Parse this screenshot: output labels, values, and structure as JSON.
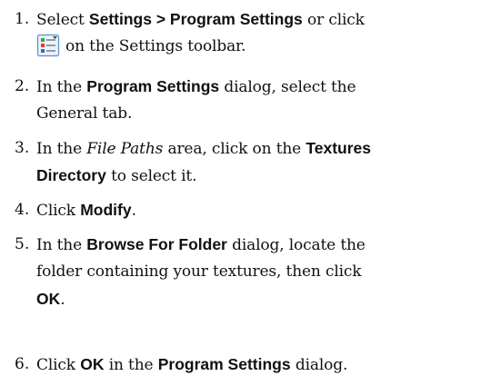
{
  "steps": [
    {
      "number": "1.",
      "line1": {
        "t1": "Select ",
        "b1": "Settings > Program Settings",
        "t2": " or click"
      },
      "line2": {
        "icon": "program-settings-icon",
        "t1": "on the Settings toolbar."
      }
    },
    {
      "number": "2.",
      "line1": {
        "t1": "In the ",
        "b1": "Program Settings",
        "t2": " dialog, select the"
      },
      "line2": {
        "t1": "General tab."
      }
    },
    {
      "number": "3.",
      "line1": {
        "t1": "In the ",
        "i1": "File Paths",
        "t2": " area, click on the ",
        "b1": "Textures"
      },
      "line2": {
        "b1": "Directory",
        "t1": " to select it."
      }
    },
    {
      "number": "4.",
      "line1": {
        "t1": "Click ",
        "b1": "Modify",
        "t2": "."
      }
    },
    {
      "number": "5.",
      "line1": {
        "t1": "In the ",
        "b1": "Browse For Folder",
        "t2": " dialog, locate the"
      },
      "line2": {
        "t1": "folder containing your textures, then click"
      },
      "line3": {
        "b1": "OK",
        "t1": "."
      }
    },
    {
      "number": "6.",
      "line1": {
        "t1": "Click ",
        "b1": "OK",
        "t2": " in the ",
        "b2": "Program Settings",
        "t3": " dialog."
      }
    }
  ],
  "icon_colors": {
    "frame": "#5b8fc7",
    "fill": "#eaf2fb",
    "green": "#3aa13a",
    "red": "#d9412f",
    "blue": "#2f6fc4",
    "lines": "#6f7f90"
  }
}
